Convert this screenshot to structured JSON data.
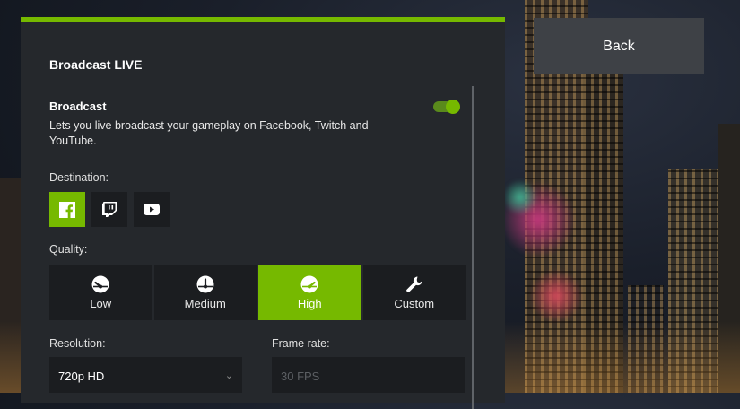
{
  "panel": {
    "title": "Broadcast LIVE",
    "broadcast": {
      "title": "Broadcast",
      "description": "Lets you live broadcast your gameplay on Facebook, Twitch and YouTube.",
      "enabled": true
    },
    "destination": {
      "label": "Destination:",
      "options": [
        {
          "icon": "facebook-icon",
          "selected": true
        },
        {
          "icon": "twitch-icon",
          "selected": false
        },
        {
          "icon": "youtube-icon",
          "selected": false
        }
      ]
    },
    "quality": {
      "label": "Quality:",
      "options": [
        {
          "label": "Low",
          "icon": "gauge-low-icon",
          "selected": false
        },
        {
          "label": "Medium",
          "icon": "gauge-medium-icon",
          "selected": false
        },
        {
          "label": "High",
          "icon": "gauge-high-icon",
          "selected": true
        },
        {
          "label": "Custom",
          "icon": "wrench-icon",
          "selected": false
        }
      ]
    },
    "resolution": {
      "label": "Resolution:",
      "value": "720p HD"
    },
    "framerate": {
      "label": "Frame rate:",
      "value": "30 FPS"
    }
  },
  "back_button": {
    "label": "Back"
  },
  "colors": {
    "accent": "#76b900",
    "panel": "#25282c",
    "control": "#1b1d20"
  }
}
